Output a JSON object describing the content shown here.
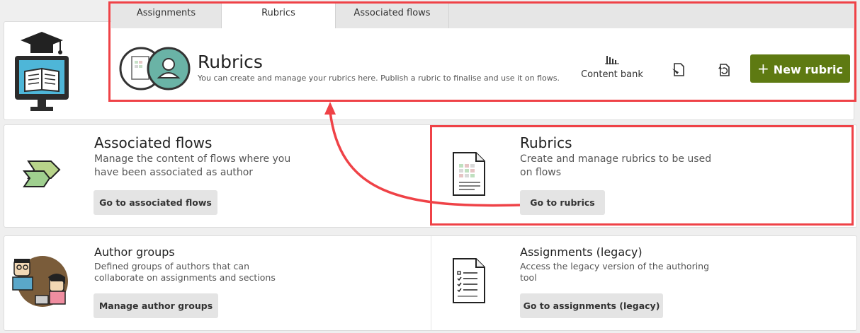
{
  "tabs": [
    {
      "label": "Assignments"
    },
    {
      "label": "Rubrics"
    },
    {
      "label": "Associated flows"
    }
  ],
  "header": {
    "title": "Rubrics",
    "subtitle": "You can create and manage your rubrics here. Publish a rubric to finalise and use it on flows.",
    "content_bank_label": "Content bank",
    "new_rubric_label": "New rubric"
  },
  "cards": {
    "associated_flows": {
      "title": "Associated flows",
      "description": "Manage the content of flows where you have been associated as author",
      "button": "Go to associated flows"
    },
    "rubrics": {
      "title": "Rubrics",
      "description": "Create and manage rubrics to be used on flows",
      "button": "Go to rubrics"
    },
    "author_groups": {
      "title": "Author groups",
      "description": "Defined groups of authors that can collaborate on assignments and sections",
      "button": "Manage author groups"
    },
    "assignments_legacy": {
      "title": "Assignments (legacy)",
      "description": "Access the legacy version of the authoring tool",
      "button": "Go to assignments (legacy)"
    }
  },
  "colors": {
    "primary": "#5e7a12",
    "highlight": "#ef4247",
    "avatar_teal": "#6ab3a6"
  },
  "icons": [
    "computer-graduate-icon",
    "rubric-document-icon",
    "user-avatar-icon",
    "bar-chart-icon",
    "edit-document-icon",
    "sync-document-icon",
    "plus-icon",
    "flow-arrows-icon",
    "rubric-sheet-icon",
    "author-group-icon",
    "checklist-document-icon"
  ]
}
